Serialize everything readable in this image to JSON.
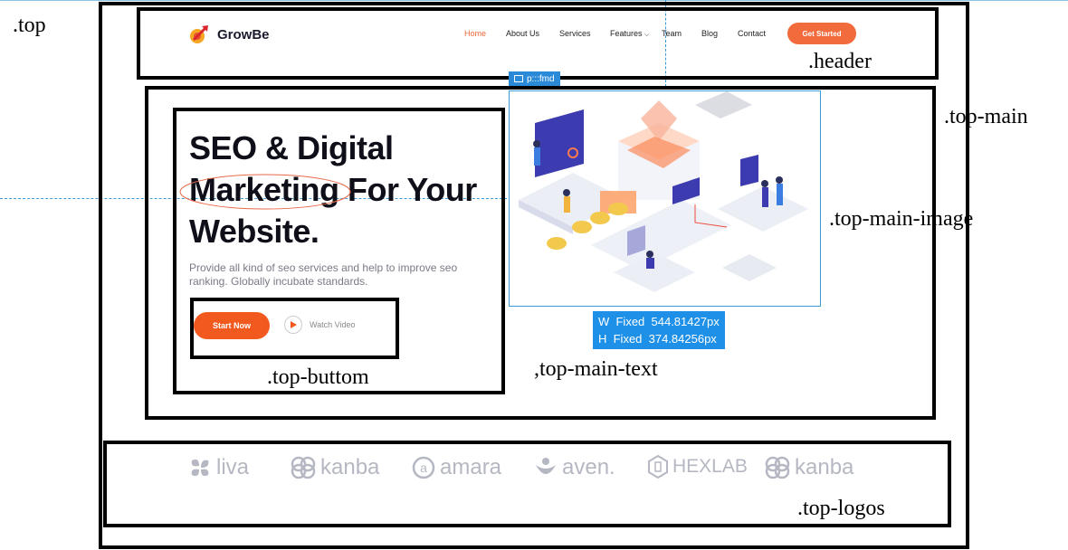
{
  "header": {
    "brand_name": "GrowBe",
    "nav": [
      "Home",
      "About Us",
      "Services",
      "Features",
      "Team",
      "Blog",
      "Contact"
    ],
    "cta_label": "Get Started"
  },
  "hero": {
    "title_line1": "SEO & Digital",
    "title_line2a": "Marketing",
    "title_line2b": " For Your",
    "title_line3": "Website.",
    "description": "Provide all kind of seo services and help to improve seo ranking. Globally incubate standards.",
    "primary_button": "Start Now",
    "secondary_button": "Watch Video"
  },
  "selection": {
    "tag_label": "p:::fmd",
    "width_label": "W  Fixed  544.81427px",
    "height_label": "H  Fixed  374.84256px"
  },
  "logos": [
    "liva",
    "kanba",
    "amara",
    "aven.",
    "HEXLAB",
    "kanba"
  ],
  "annotations": {
    "top": ".top",
    "header": ".header",
    "top_main": ".top-main",
    "top_main_image": ".top-main-image",
    "top_main_text": ",top-main-text",
    "top_buttom": ".top-buttom",
    "top_logos": ".top-logos"
  },
  "colors": {
    "accent": "#f2591f",
    "logo_gray": "#b5b8c2",
    "guide_blue": "#3a9ad9"
  }
}
